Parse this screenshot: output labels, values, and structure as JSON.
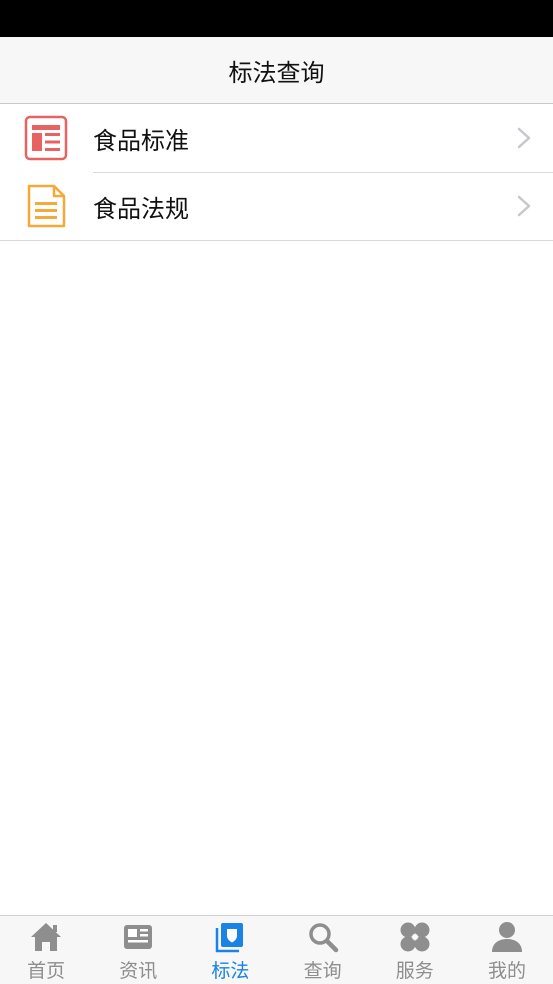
{
  "header": {
    "title": "标法查询"
  },
  "list": {
    "items": [
      {
        "label": "食品标准",
        "icon": "standards-document-icon",
        "icon_color": "#e8635f"
      },
      {
        "label": "食品法规",
        "icon": "regulations-document-icon",
        "icon_color": "#f5a938"
      }
    ]
  },
  "tabbar": {
    "active_color": "#1a83e5",
    "inactive_color": "#8e8e8e",
    "items": [
      {
        "label": "首页",
        "icon": "home-icon",
        "active": false
      },
      {
        "label": "资讯",
        "icon": "news-icon",
        "active": false
      },
      {
        "label": "标法",
        "icon": "standards-icon",
        "active": true
      },
      {
        "label": "查询",
        "icon": "search-icon",
        "active": false
      },
      {
        "label": "服务",
        "icon": "services-icon",
        "active": false
      },
      {
        "label": "我的",
        "icon": "profile-icon",
        "active": false
      }
    ]
  }
}
